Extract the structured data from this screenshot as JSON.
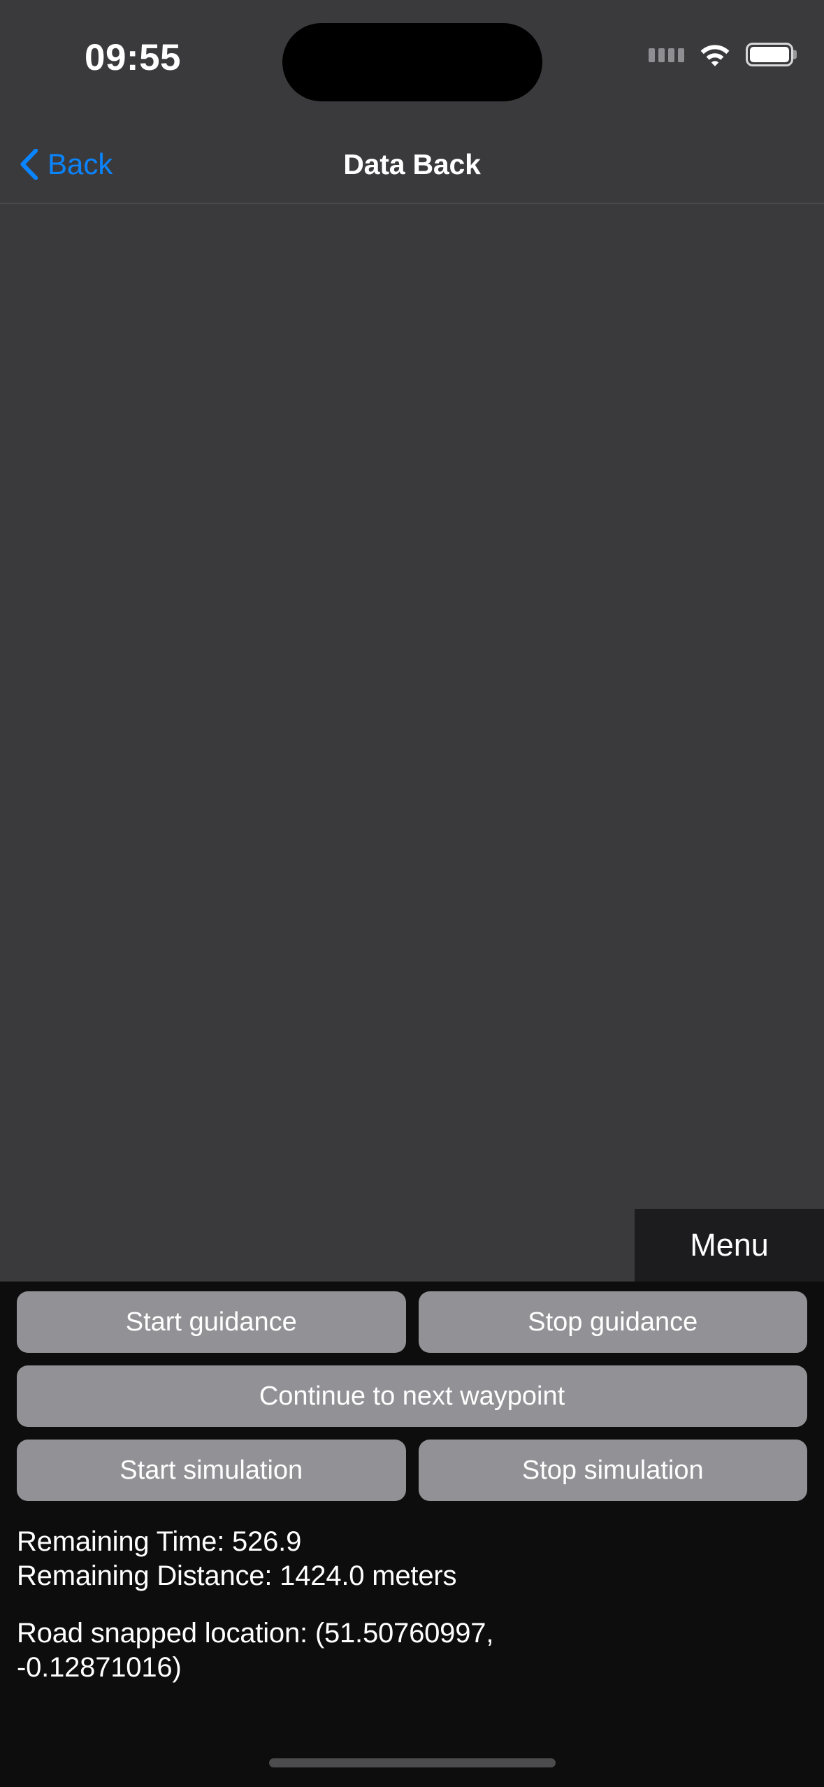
{
  "status_bar": {
    "time": "09:55",
    "signal_icon": "cellular-dots-icon",
    "wifi_icon": "wifi-icon",
    "battery_icon": "battery-full-icon"
  },
  "nav_bar": {
    "back_label": "Back",
    "back_icon": "chevron-left-icon",
    "title": "Data Back"
  },
  "map": {
    "menu_label": "Menu"
  },
  "controls": {
    "row1": [
      "Start guidance",
      "Stop guidance"
    ],
    "row2": [
      "Continue to next waypoint"
    ],
    "row3": [
      "Start simulation",
      "Stop simulation"
    ]
  },
  "info": {
    "remaining_time": "Remaining Time: 526.9",
    "remaining_distance": "Remaining Distance: 1424.0 meters",
    "road_snapped_location": "Road snapped location: (51.50760997, -0.12871016)"
  },
  "colors": {
    "accent_blue": "#0a84ff",
    "map_background": "#3a3a3c",
    "panel_background": "#0d0d0d",
    "button_grey": "#919196",
    "menu_background": "#1c1c1e"
  }
}
